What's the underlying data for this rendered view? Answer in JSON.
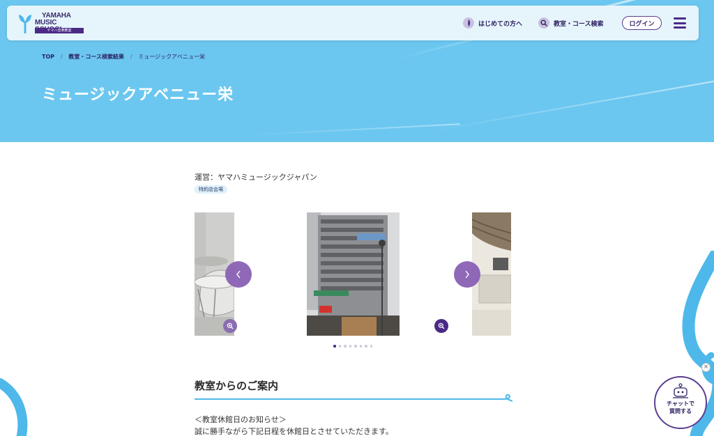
{
  "header": {
    "logo": {
      "line1": "YAMAHA",
      "line2": "MUSIC SCHOOL",
      "sub": "ヤマハ音楽教室"
    },
    "nav_first": "はじめての方へ",
    "nav_search": "教室・コース検索",
    "login_label": "ログイン",
    "icons": {
      "first": "leaf-icon",
      "search": "search-icon",
      "menu": "hamburger-menu-icon"
    }
  },
  "breadcrumb": {
    "items": [
      "TOP",
      "教室・コース検索結果",
      "ミュージックアベニュー栄"
    ],
    "separator": "/"
  },
  "page": {
    "title": "ミュージックアベニュー栄"
  },
  "school": {
    "operator": "運営：ヤマハミュージックジャパン",
    "tag": "特約店会場"
  },
  "carousel": {
    "slides": [
      "drum-studio-photo",
      "building-exterior-photo",
      "lobby-interior-photo"
    ],
    "dot_count": 8,
    "active_index": 0
  },
  "section": {
    "title": "教室からのご案内",
    "notice_heading": "＜教室休館日のお知らせ＞",
    "notice_body": "誠に勝手ながら下記日程を休館日とさせていただきます。"
  },
  "chat": {
    "line1": "チャットで",
    "line2": "質問する",
    "close": "×"
  },
  "colors": {
    "hero_bg": "#6cc7f0",
    "header_bg": "#e6f5fc",
    "brand_purple": "#4b2a86",
    "accent_purple": "#8a62b5",
    "accent_blue": "#4fb8ea"
  }
}
